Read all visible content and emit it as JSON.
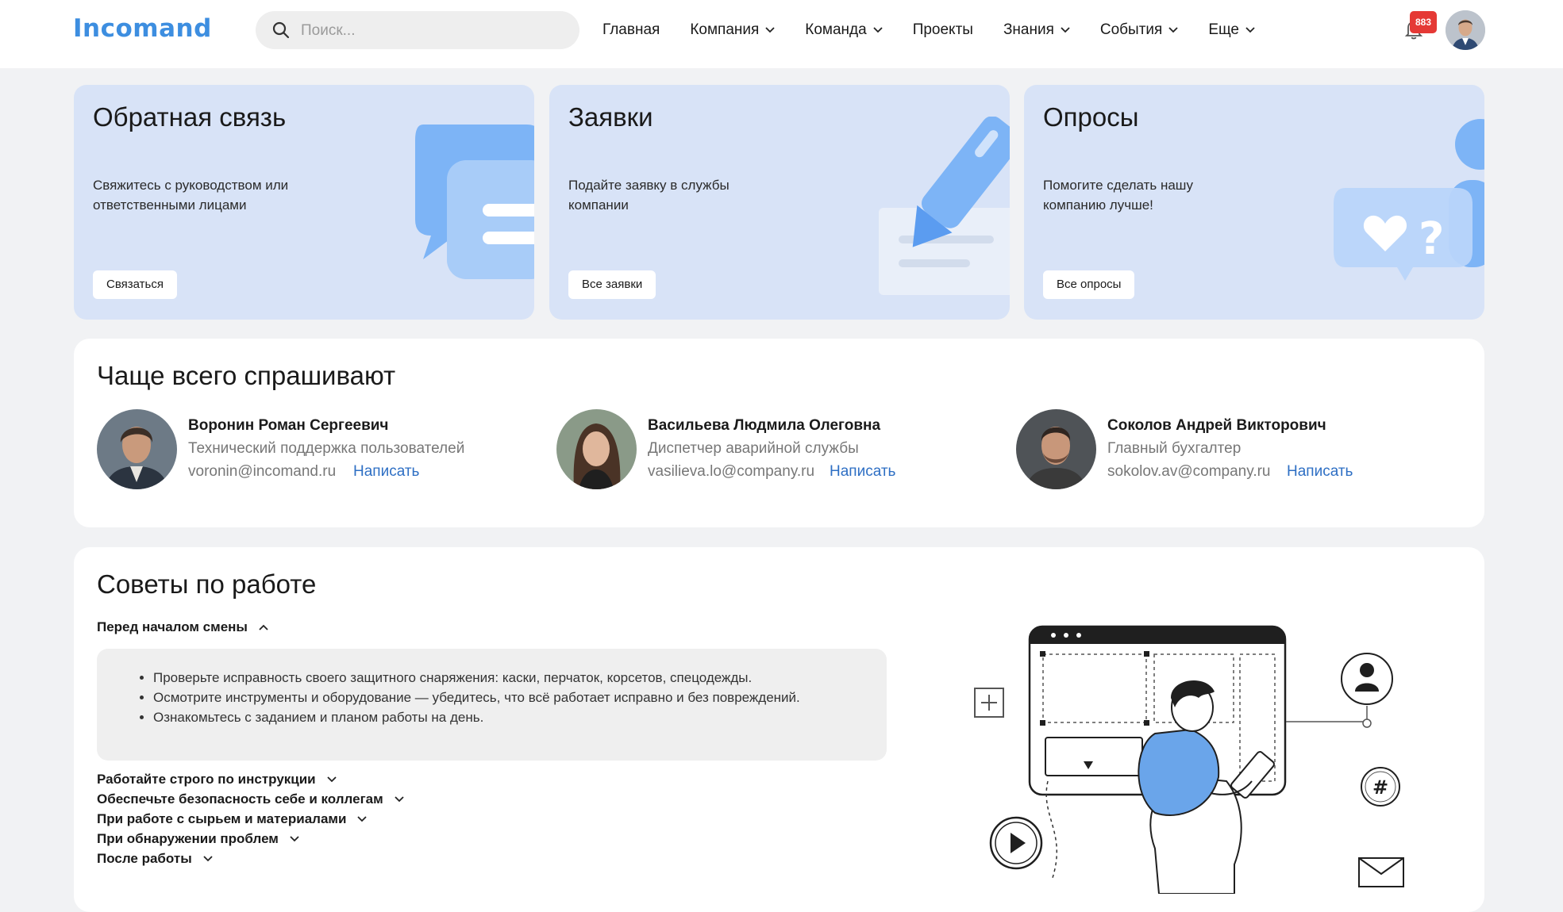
{
  "header": {
    "logo": "Incomand",
    "search_placeholder": "Поиск...",
    "nav": [
      {
        "label": "Главная",
        "dropdown": false
      },
      {
        "label": "Компания",
        "dropdown": true
      },
      {
        "label": "Команда",
        "dropdown": true
      },
      {
        "label": "Проекты",
        "dropdown": false
      },
      {
        "label": "Знания",
        "dropdown": true
      },
      {
        "label": "События",
        "dropdown": true
      },
      {
        "label": "Еще",
        "dropdown": true
      }
    ],
    "notifications_count": "883"
  },
  "cards": [
    {
      "title": "Обратная связь",
      "text": "Свяжитесь с руководством или ответственными лицами",
      "button": "Связаться",
      "icon": "chat-bubbles-icon"
    },
    {
      "title": "Заявки",
      "text": "Подайте заявку в службы компании",
      "button": "Все заявки",
      "icon": "pencil-icon"
    },
    {
      "title": "Опросы",
      "text": "Помогите сделать нашу компанию лучше!",
      "button": "Все опросы",
      "icon": "heart-question-icon"
    }
  ],
  "faq": {
    "title": "Чаще всего спрашивают",
    "people": [
      {
        "name": "Воронин Роман Сергеевич",
        "role": "Технический поддержка пользователей",
        "email": "voronin@incomand.ru",
        "action": "Написать"
      },
      {
        "name": "Васильева Людмила Олеговна",
        "role": "Диспетчер аварийной службы",
        "email": "vasilieva.lo@company.ru",
        "action": "Написать"
      },
      {
        "name": "Соколов Андрей Викторович",
        "role": "Главный бухгалтер",
        "email": "sokolov.av@company.ru",
        "action": "Написать"
      }
    ]
  },
  "tips": {
    "title": "Советы по работе",
    "open_section": {
      "label": "Перед началом смены",
      "items": [
        "Проверьте исправность своего защитного снаряжения: каски, перчаток, корсетов, спецодежды.",
        "Осмотрите инструменты и оборудование — убедитесь, что всё работает исправно и без повреждений.",
        "Ознакомьтесь с заданием и планом работы на день."
      ]
    },
    "sections": [
      "Работайте строго по инструкции",
      "Обеспечьте безопасность себе и коллегам",
      "При работе с сырьем и материалами",
      "При обнаружении проблем",
      "После работы"
    ]
  },
  "colors": {
    "brand": "#3d8ee0",
    "link": "#2e6fc4",
    "badge": "#e53935",
    "card_bg": "#d8e3f7",
    "illustration_accent": "#6aa5ea"
  }
}
